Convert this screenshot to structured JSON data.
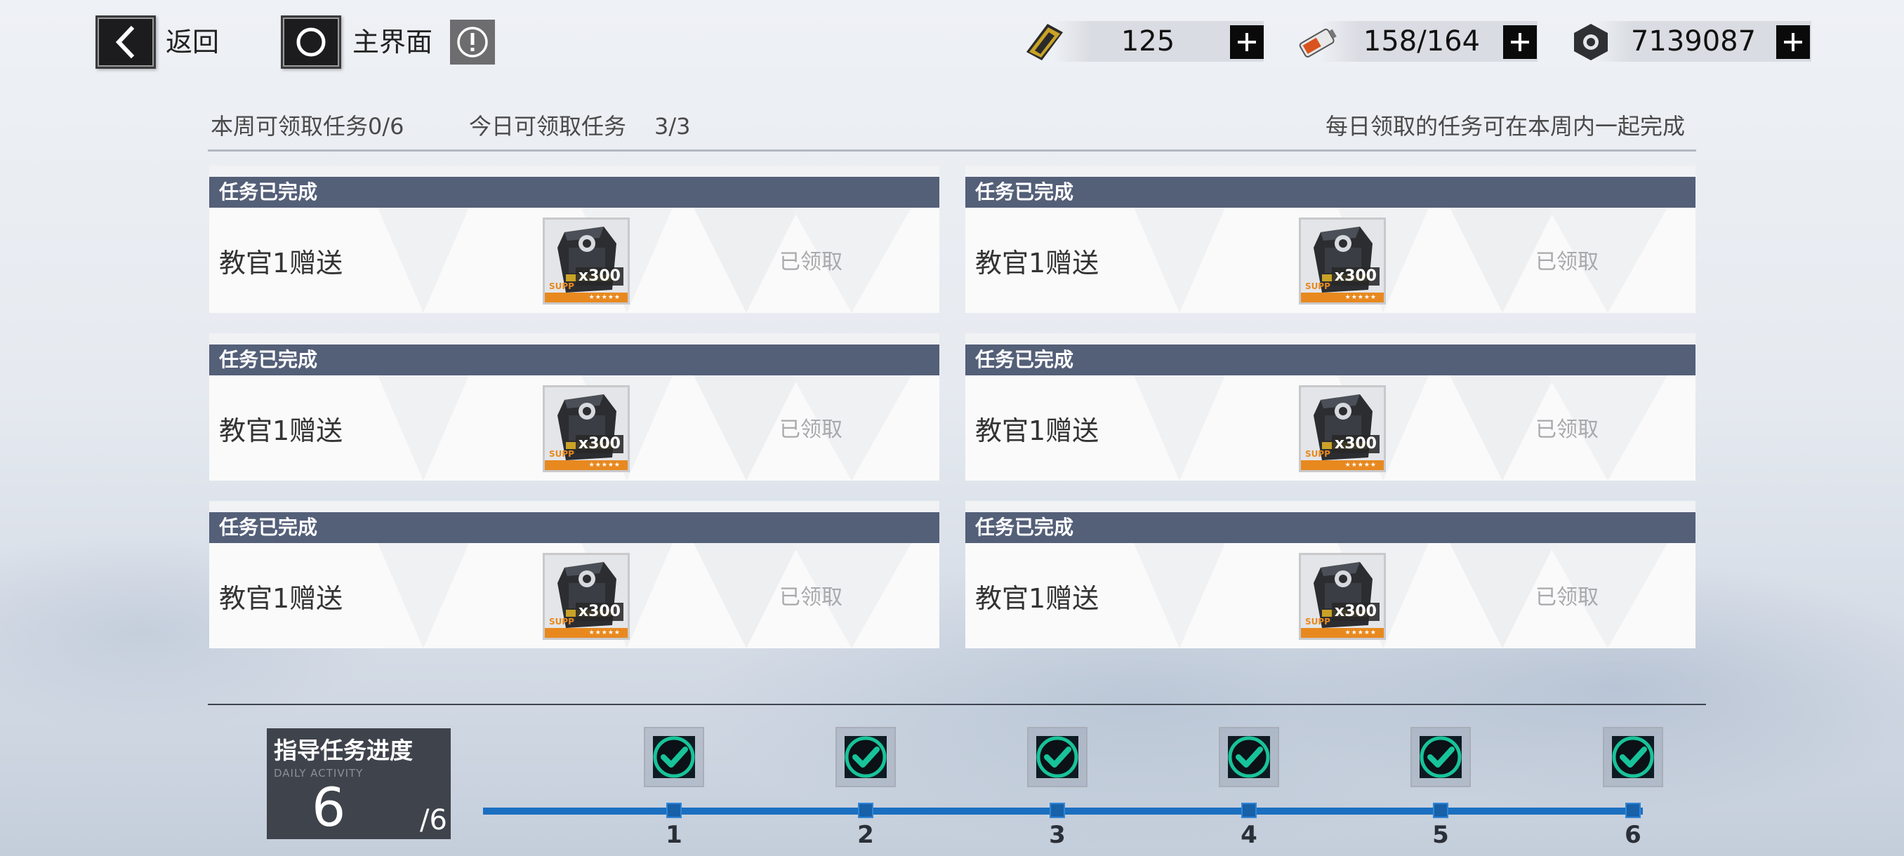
{
  "nav": {
    "back_label": "返回",
    "home_label": "主界面"
  },
  "resources": [
    {
      "icon": "gold-ticket-icon",
      "value": "125"
    },
    {
      "icon": "battery-icon",
      "value": "158/164"
    },
    {
      "icon": "component-nut-icon",
      "value": "7139087"
    }
  ],
  "info": {
    "weekly_label": "本周可领取任务0/6",
    "daily_label": "今日可领取任务",
    "daily_value": "3/3",
    "hint": "每日领取的任务可在本周内一起完成"
  },
  "tasks": [
    {
      "header": "任务已完成",
      "name": "教官1赠送",
      "reward_qty": "x300",
      "reward_tag": "SUPP",
      "status": "已领取"
    },
    {
      "header": "任务已完成",
      "name": "教官1赠送",
      "reward_qty": "x300",
      "reward_tag": "SUPP",
      "status": "已领取"
    },
    {
      "header": "任务已完成",
      "name": "教官1赠送",
      "reward_qty": "x300",
      "reward_tag": "SUPP",
      "status": "已领取"
    },
    {
      "header": "任务已完成",
      "name": "教官1赠送",
      "reward_qty": "x300",
      "reward_tag": "SUPP",
      "status": "已领取"
    },
    {
      "header": "任务已完成",
      "name": "教官1赠送",
      "reward_qty": "x300",
      "reward_tag": "SUPP",
      "status": "已领取"
    },
    {
      "header": "任务已完成",
      "name": "教官1赠送",
      "reward_qty": "x300",
      "reward_tag": "SUPP",
      "status": "已领取"
    }
  ],
  "progress": {
    "title": "指导任务进度",
    "subtitle": "DAILY ACTIVITY",
    "current": "6",
    "total": "/6",
    "fraction": 1.0,
    "milestones": [
      {
        "label": "1",
        "claimed": true
      },
      {
        "label": "2",
        "claimed": true
      },
      {
        "label": "3",
        "claimed": true
      },
      {
        "label": "4",
        "claimed": true
      },
      {
        "label": "5",
        "claimed": true
      },
      {
        "label": "6",
        "claimed": true
      }
    ]
  },
  "colors": {
    "card_header": "#545f78",
    "progress_track": "#1b6fc0",
    "check_green": "#18c39a",
    "reward_orange": "#e8891f"
  }
}
